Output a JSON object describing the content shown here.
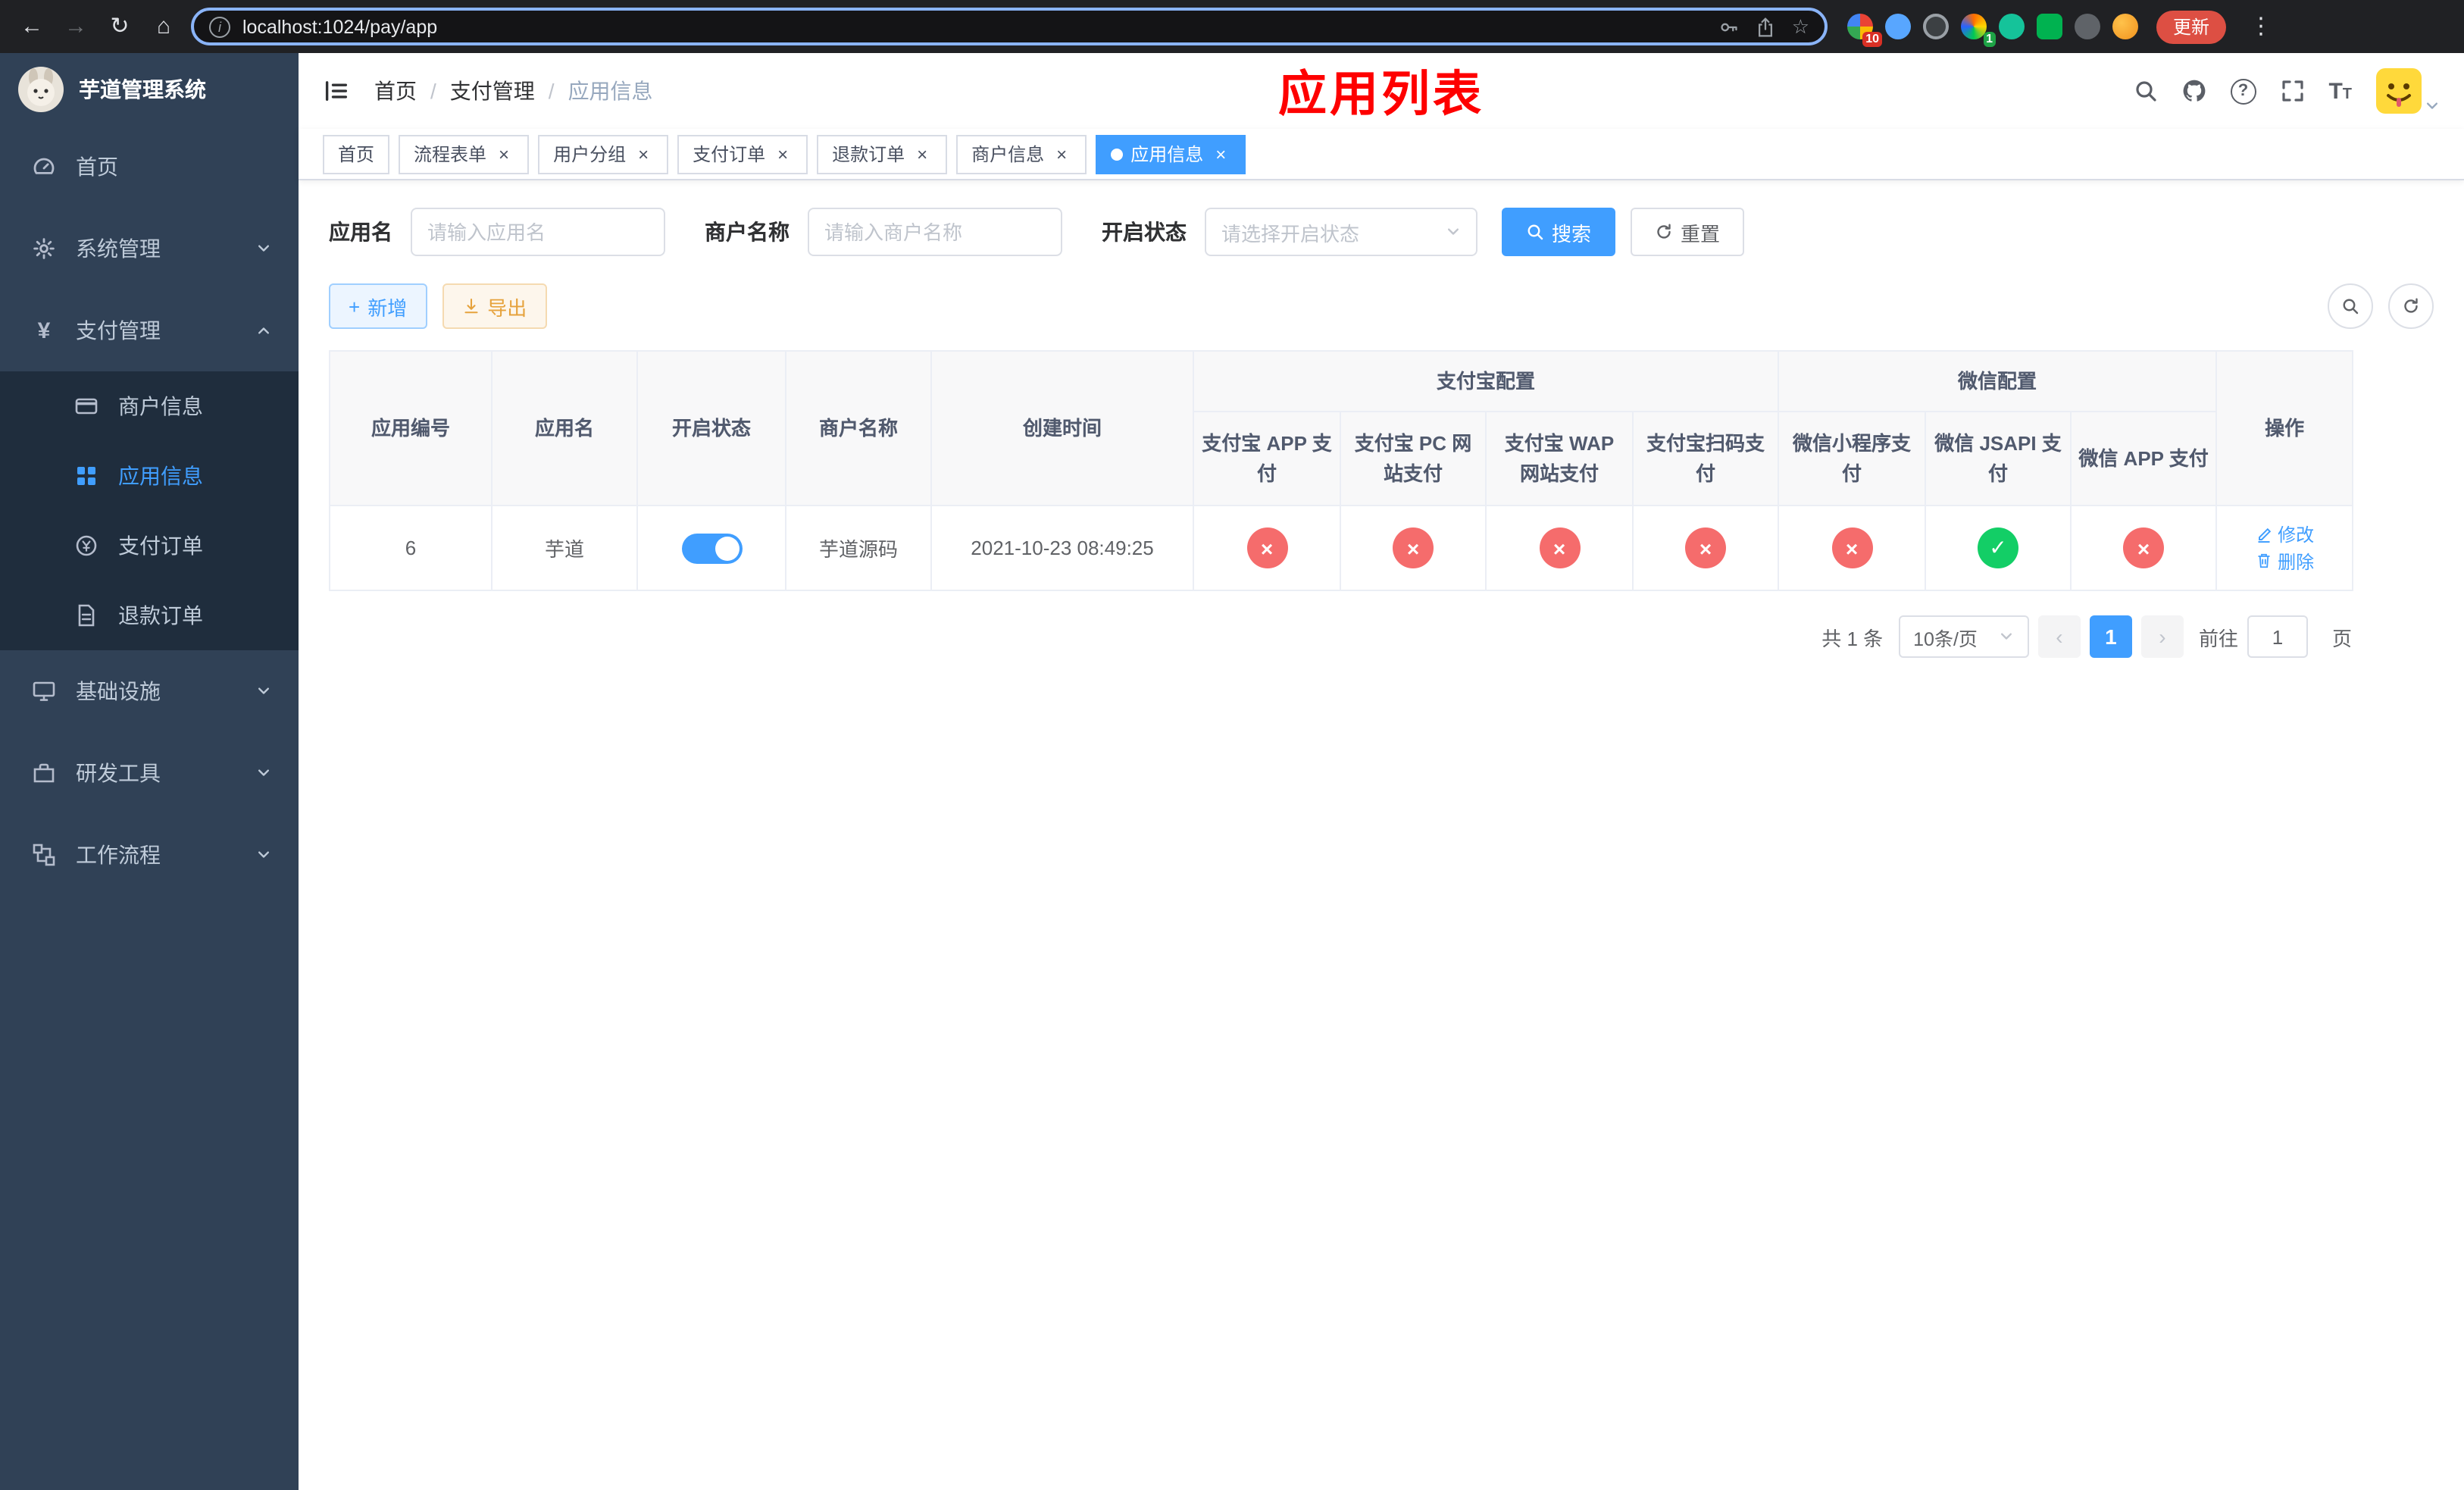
{
  "colors": {
    "accent": "#409eff",
    "danger": "#f56c6c",
    "success": "#13ce66",
    "sidebar_bg": "#304156",
    "submenu_bg": "#1f2d3d",
    "title_red": "#fe0000",
    "tab_active_bg": "#409eff"
  },
  "icons": {
    "back": "←",
    "forward": "→",
    "reload": "↻",
    "home": "⌂",
    "overflow": "⋮",
    "star": "☆",
    "info": "i",
    "close": "×",
    "check": "✓",
    "cross": "×",
    "prev": "‹",
    "next": "›",
    "plus": "+",
    "question": "?"
  },
  "browser": {
    "url": "localhost:1024/pay/app",
    "update_button": "更新",
    "ext_badge_1": "10",
    "ext_badge_2": "1"
  },
  "sidebar": {
    "logo_title": "芋道管理系统",
    "items": [
      {
        "label": "首页"
      },
      {
        "label": "系统管理"
      },
      {
        "label": "支付管理"
      },
      {
        "label": "基础设施"
      },
      {
        "label": "研发工具"
      },
      {
        "label": "工作流程"
      }
    ],
    "submenu": [
      {
        "label": "商户信息"
      },
      {
        "label": "应用信息"
      },
      {
        "label": "支付订单"
      },
      {
        "label": "退款订单"
      }
    ]
  },
  "header": {
    "breadcrumb": [
      "首页",
      "支付管理",
      "应用信息"
    ],
    "page_title": "应用列表",
    "font_icon_big": "T",
    "font_icon_small": "T"
  },
  "tabs": {
    "items": [
      "首页",
      "流程表单",
      "用户分组",
      "支付订单",
      "退款订单",
      "商户信息",
      "应用信息"
    ],
    "active_index": 6
  },
  "filters": {
    "app_name": {
      "label": "应用名",
      "placeholder": "请输入应用名",
      "value": ""
    },
    "merchant_name": {
      "label": "商户名称",
      "placeholder": "请输入商户名称",
      "value": ""
    },
    "status": {
      "label": "开启状态",
      "placeholder": "请选择开启状态"
    },
    "search": "搜索",
    "reset": "重置"
  },
  "toolbar": {
    "add": "新增",
    "export": "导出"
  },
  "table": {
    "groups": {
      "alipay": "支付宝配置",
      "wechat": "微信配置"
    },
    "columns": {
      "app_id": "应用编号",
      "app_name": "应用名",
      "status": "开启状态",
      "merchant": "商户名称",
      "created": "创建时间",
      "alipay_app": "支付宝 APP 支付",
      "alipay_pc": "支付宝 PC 网站支付",
      "alipay_wap": "支付宝 WAP 网站支付",
      "alipay_qr": "支付宝扫码支付",
      "wx_lite": "微信小程序支付",
      "wx_jsapi": "微信 JSAPI 支付",
      "wx_app": "微信 APP 支付",
      "actions": "操作"
    },
    "rows": [
      {
        "app_id": "6",
        "app_name": "芋道",
        "enabled": true,
        "merchant": "芋道源码",
        "created": "2021-10-23 08:49:25",
        "alipay_app": false,
        "alipay_pc": false,
        "alipay_wap": false,
        "alipay_qr": false,
        "wx_lite": false,
        "wx_jsapi": true,
        "wx_app": false,
        "edit": "修改",
        "delete": "删除"
      }
    ]
  },
  "pagination": {
    "total": "共 1 条",
    "page_size": "10条/页",
    "page": "1",
    "goto_prefix": "前往",
    "goto_value": "1",
    "goto_suffix": "页"
  }
}
